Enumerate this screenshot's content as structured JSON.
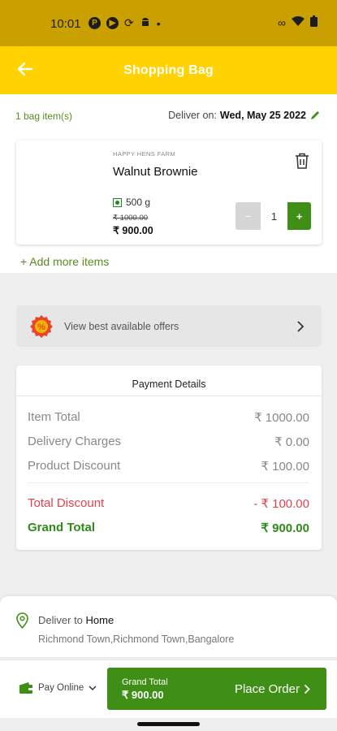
{
  "status_bar": {
    "time": "10:01",
    "icons": [
      "media-icon",
      "media-icon",
      "sync-icon",
      "android-icon",
      "notification-dot"
    ],
    "right_icons": [
      "link-icon",
      "wifi-icon",
      "battery-icon"
    ]
  },
  "header": {
    "title": "Shopping Bag",
    "back_icon": "back-arrow-icon",
    "bg_color": "#ffd200"
  },
  "bag": {
    "count": "1 bag item(s)",
    "deliver_label": "Deliver on:",
    "deliver_date": "Wed, May 25 2022"
  },
  "item": {
    "farm": "HAPPY HENS FARM",
    "name": "Walnut Brownie",
    "variant": "500 g",
    "old_price": "₹ 1000.00",
    "price": "₹  900.00",
    "quantity": "1",
    "minus": "−",
    "plus": "+"
  },
  "add_more": "+ Add more items",
  "offers": {
    "text": "View best available offers",
    "icon": "discount-badge-icon"
  },
  "payment": {
    "title": "Payment Details",
    "rows": [
      {
        "label": "Item Total",
        "value": "₹ 1000.00"
      },
      {
        "label": "Delivery Charges",
        "value": "₹ 0.00"
      },
      {
        "label": "Product Discount",
        "value": "₹ 100.00"
      }
    ],
    "total_discount": {
      "label": "Total Discount",
      "value": "- ₹ 100.00"
    },
    "grand_total": {
      "label": "Grand Total",
      "value": "₹ 900.00"
    }
  },
  "delivery": {
    "prefix": "Deliver to",
    "place": "Home",
    "address": "Richmond Town,Richmond Town,Bangalore"
  },
  "bottom": {
    "pay_method": "Pay Online",
    "grand_total_label": "Grand Total",
    "grand_total_value": "₹ 900.00",
    "place_order": "Place Order"
  },
  "colors": {
    "brand_yellow": "#ffd200",
    "primary_green": "#3f8f17",
    "discount_red": "#e4424d"
  }
}
